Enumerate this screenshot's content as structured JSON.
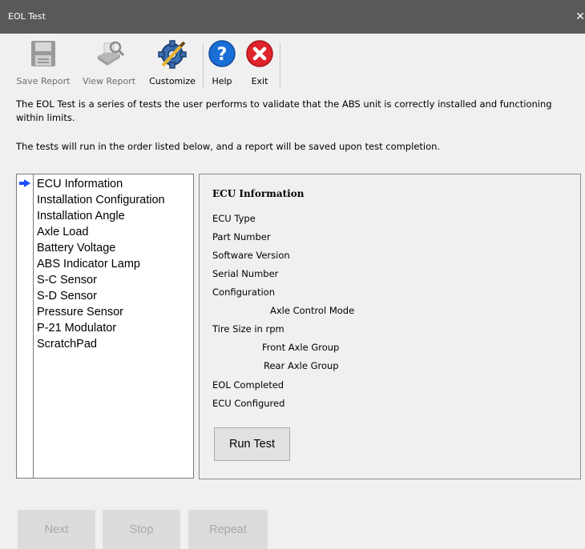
{
  "window": {
    "title": "EOL Test",
    "close_glyph": "✕"
  },
  "toolbar": {
    "save_report": "Save Report",
    "view_report": "View Report",
    "customize": "Customize",
    "help": "Help",
    "exit": "Exit"
  },
  "description": {
    "line1": "The EOL Test is a series of tests the user performs to validate that the ABS unit is correctly installed and functioning within limits.",
    "line2": "The tests will run in the order listed below, and a report will be saved upon test completion."
  },
  "tests": [
    "ECU Information",
    "Installation Configuration",
    "Installation Angle",
    "Axle Load",
    "Battery Voltage",
    "ABS Indicator Lamp",
    "S-C Sensor",
    "S-D Sensor",
    "Pressure Sensor",
    "P-21 Modulator",
    "ScratchPad"
  ],
  "current_test_index": 0,
  "info": {
    "title": "ECU Information",
    "rows": {
      "ecu_type": "ECU Type",
      "part_number": "Part Number",
      "software_version": "Software Version",
      "serial_number": "Serial Number",
      "configuration": "Configuration",
      "axle_control_mode": "Axle Control Mode",
      "tire_size": "Tire Size in rpm",
      "front_axle_group": "Front Axle Group",
      "rear_axle_group": "Rear Axle Group",
      "eol_completed": "EOL Completed",
      "ecu_configured": "ECU Configured"
    },
    "run_test": "Run Test"
  },
  "nav": {
    "next": "Next",
    "stop": "Stop",
    "repeat": "Repeat"
  },
  "colors": {
    "titlebar": "#595959",
    "arrow": "#1e4fff",
    "help": "#1a6fd6",
    "exit": "#e0242b"
  }
}
